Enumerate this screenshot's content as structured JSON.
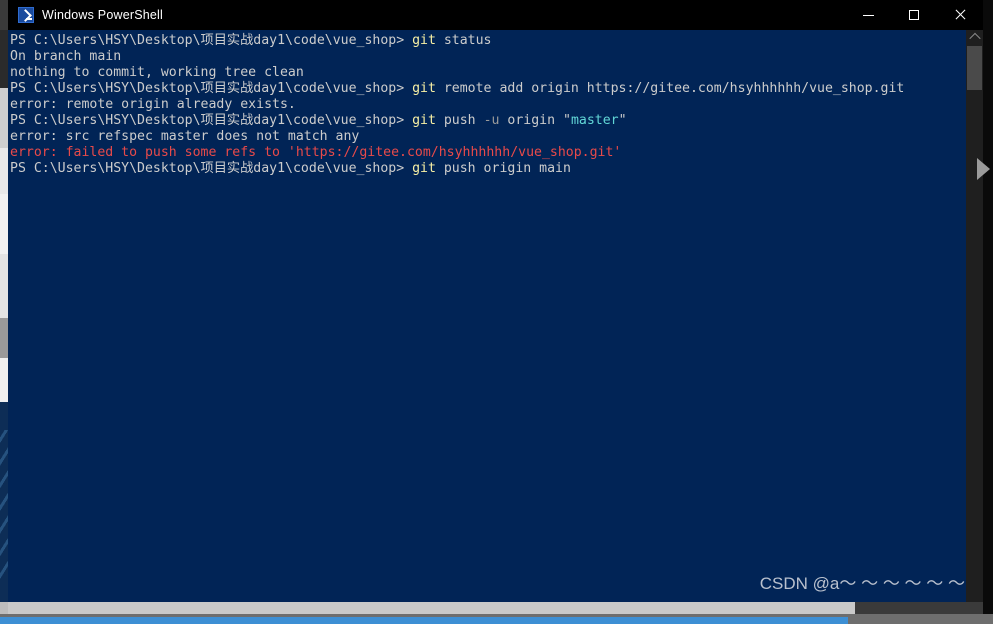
{
  "window": {
    "title": "Windows PowerShell",
    "icon": "powershell-icon",
    "controls": {
      "minimize": "minimize-button",
      "maximize": "maximize-button",
      "close": "close-button"
    }
  },
  "colors": {
    "background": "#012456",
    "titlebar": "#000000",
    "text_white": "#cccccc",
    "text_yellow": "#f9f1a5",
    "text_cyan": "#61d6d6",
    "text_gray": "#9a9a9a",
    "text_red": "#e84a4a"
  },
  "console": {
    "prompt_path": "PS C:\\Users\\HSY\\Desktop\\项目实战day1\\code\\vue_shop> ",
    "lines": [
      {
        "name": "line-git-status",
        "segments": [
          {
            "text": "PS C:\\Users\\HSY\\Desktop\\项目实战day1\\code\\vue_shop> ",
            "color": "white"
          },
          {
            "text": "git",
            "color": "yellow"
          },
          {
            "text": " status",
            "color": "white"
          }
        ]
      },
      {
        "name": "line-on-branch-main",
        "segments": [
          {
            "text": "On branch main",
            "color": "white"
          }
        ]
      },
      {
        "name": "line-nothing-to-commit",
        "segments": [
          {
            "text": "nothing to commit, working tree clean",
            "color": "white"
          }
        ]
      },
      {
        "name": "line-git-remote-add",
        "segments": [
          {
            "text": "PS C:\\Users\\HSY\\Desktop\\项目实战day1\\code\\vue_shop> ",
            "color": "white"
          },
          {
            "text": "git",
            "color": "yellow"
          },
          {
            "text": " remote add origin https://gitee.com/hsyhhhhhh/vue_shop.git",
            "color": "white"
          }
        ]
      },
      {
        "name": "line-error-remote-exists",
        "segments": [
          {
            "text": "error: remote origin already exists.",
            "color": "white"
          }
        ]
      },
      {
        "name": "line-git-push-u-origin-master",
        "segments": [
          {
            "text": "PS C:\\Users\\HSY\\Desktop\\项目实战day1\\code\\vue_shop> ",
            "color": "white"
          },
          {
            "text": "git",
            "color": "yellow"
          },
          {
            "text": " push ",
            "color": "white"
          },
          {
            "text": "-u",
            "color": "gray"
          },
          {
            "text": " origin ",
            "color": "white"
          },
          {
            "text": "\"",
            "color": "white"
          },
          {
            "text": "master",
            "color": "cyan"
          },
          {
            "text": "\"",
            "color": "white"
          }
        ]
      },
      {
        "name": "line-error-src-refspec",
        "segments": [
          {
            "text": "error: src refspec master does not match any",
            "color": "white"
          }
        ]
      },
      {
        "name": "line-error-failed-to-push",
        "segments": [
          {
            "text": "error: failed to push some refs to 'https://gitee.com/hsyhhhhhh/vue_shop.git'",
            "color": "red"
          }
        ]
      },
      {
        "name": "line-git-push-origin-main",
        "segments": [
          {
            "text": "PS C:\\Users\\HSY\\Desktop\\项目实战day1\\code\\vue_shop> ",
            "color": "white"
          },
          {
            "text": "git",
            "color": "yellow"
          },
          {
            "text": " push origin main",
            "color": "white"
          }
        ]
      }
    ]
  },
  "watermark": {
    "text": "CSDN @a～ ～ ～ ～ ～ ～"
  },
  "scrollbars": {
    "vertical_arrow_up": "scroll-up-arrow",
    "vertical_thumb": "vertical-scroll-thumb",
    "horizontal_thumb": "horizontal-scroll-thumb"
  }
}
